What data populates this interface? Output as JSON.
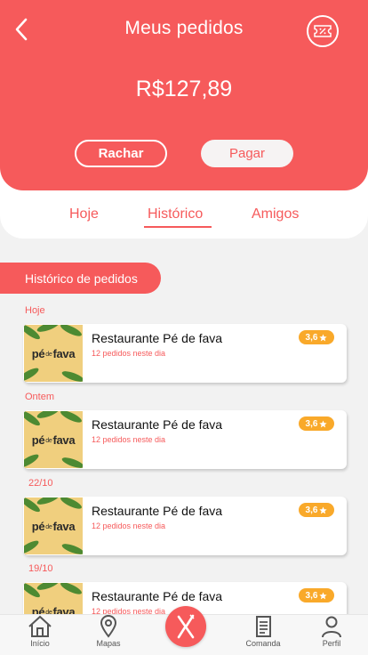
{
  "header": {
    "title": "Meus pedidos",
    "amount": "R$127,89",
    "split_label": "Rachar",
    "pay_label": "Pagar"
  },
  "tabs": [
    {
      "label": "Hoje"
    },
    {
      "label": "Histórico",
      "active": true
    },
    {
      "label": "Amigos"
    }
  ],
  "section_title": "Histórico de pedidos",
  "groups": [
    {
      "date": "Hoje",
      "name": "Restaurante Pé de fava",
      "sub": "12 pedidos neste dia",
      "rating": "3,6"
    },
    {
      "date": "Ontem",
      "name": "Restaurante Pé de fava",
      "sub": "12 pedidos neste dia",
      "rating": "3,6"
    },
    {
      "date": "22/10",
      "name": "Restaurante Pé de fava",
      "sub": "12 pedidos neste dia",
      "rating": "3,6"
    },
    {
      "date": "19/10",
      "name": "Restaurante Pé de fava",
      "sub": "12 pedidos neste dia",
      "rating": "3,6"
    }
  ],
  "logo_text": {
    "part1": "pé",
    "part2": "de",
    "part3": "fava"
  },
  "rating_icon": "star-icon",
  "nav": [
    {
      "label": "Início",
      "icon": "home-icon"
    },
    {
      "label": "Mapas",
      "icon": "map-pin-icon"
    },
    {
      "label": "",
      "icon": "utensils-icon"
    },
    {
      "label": "Comanda",
      "icon": "document-icon"
    },
    {
      "label": "Perfil",
      "icon": "user-icon"
    }
  ],
  "colors": {
    "accent": "#f65a5b",
    "rating": "#f9a92a",
    "logo_bg": "#f0cf7e"
  }
}
